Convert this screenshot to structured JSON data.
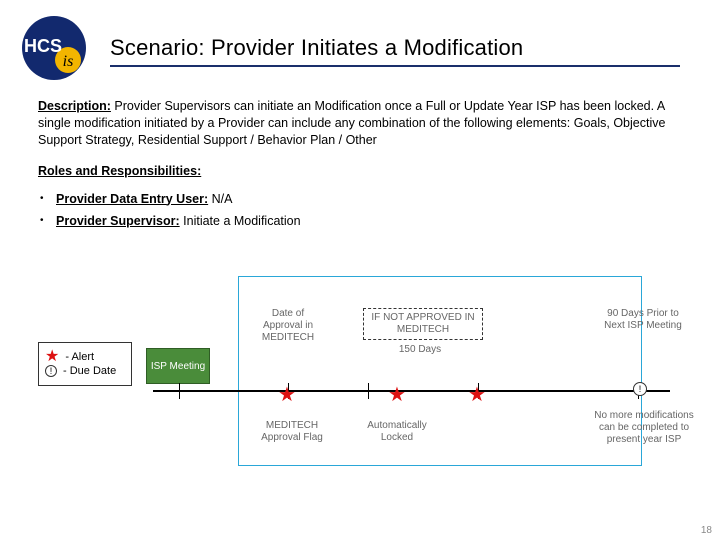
{
  "header": {
    "logo": {
      "text_main": "HCS",
      "text_sub": "is"
    },
    "title": "Scenario: Provider Initiates a Modification"
  },
  "description": {
    "label": "Description:",
    "text": "Provider Supervisors can initiate an Modification once a Full or Update Year ISP has been locked. A single modification initiated by a Provider can include any combination of the following elements: Goals, Objective Support Strategy, Residential Support / Behavior Plan / Other"
  },
  "roles": {
    "label": "Roles and Responsibilities:",
    "items": [
      {
        "role": "Provider Data Entry User:",
        "detail": "N/A"
      },
      {
        "role": "Provider Supervisor:",
        "detail": "Initiate a Modification"
      }
    ]
  },
  "diagram": {
    "legend": {
      "alert": "- Alert",
      "due": "- Due Date"
    },
    "isp_meeting": "ISP Meeting",
    "labels": {
      "date_approval": "Date of Approval in MEDITECH",
      "not_approved": "IF NOT APPROVED IN MEDITECH",
      "days_150": "150 Days",
      "ninety_days": "90 Days Prior to Next ISP Meeting",
      "approval_flag": "MEDITECH Approval Flag",
      "auto_locked": "Automatically Locked",
      "no_more": "No more modifications can be completed to present year ISP"
    }
  },
  "page_number": "18"
}
